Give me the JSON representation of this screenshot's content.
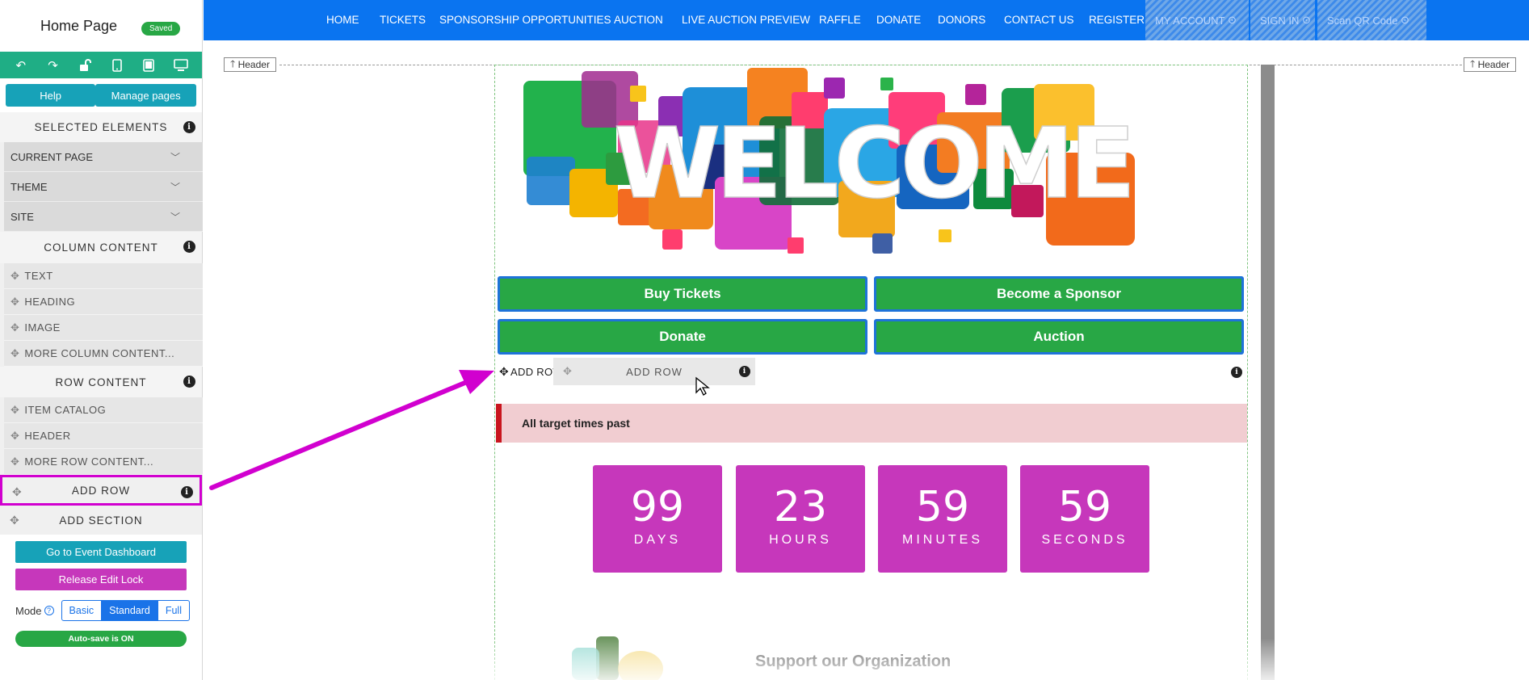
{
  "sidebar": {
    "page_title": "Home Page",
    "saved_badge": "Saved",
    "tools": [
      "undo-icon",
      "redo-icon",
      "lock-open-icon",
      "mobile-icon",
      "tablet-icon",
      "desktop-icon"
    ],
    "help_label": "Help",
    "manage_pages_label": "Manage pages",
    "selected_elements": "SELECTED ELEMENTS",
    "dropdowns": [
      "CURRENT PAGE",
      "THEME",
      "SITE"
    ],
    "column_content": "COLUMN CONTENT",
    "column_items": [
      "TEXT",
      "HEADING",
      "IMAGE",
      "MORE COLUMN CONTENT..."
    ],
    "row_content": "ROW CONTENT",
    "row_items": [
      "ITEM CATALOG",
      "HEADER",
      "MORE ROW CONTENT..."
    ],
    "add_row": "ADD ROW",
    "add_section": "ADD SECTION",
    "event_dashboard": "Go to Event Dashboard",
    "release_lock": "Release Edit Lock",
    "mode_label": "Mode",
    "modes": [
      "Basic",
      "Standard",
      "Full"
    ],
    "active_mode": "Standard",
    "autosave": "Auto-save is ON"
  },
  "nav": {
    "items": [
      "HOME",
      "TICKETS",
      "SPONSORSHIP OPPORTUNITIES",
      "AUCTION",
      "LIVE AUCTION PREVIEW",
      "RAFFLE",
      "DONATE",
      "DONORS",
      "CONTACT US",
      "REGISTER"
    ],
    "hatched": [
      "MY ACCOUNT",
      "SIGN IN",
      "Scan QR Code"
    ]
  },
  "canvas": {
    "header_tag": "Header",
    "welcome_text": "WELCOME",
    "buttons": [
      "Buy Tickets",
      "Become a Sponsor",
      "Donate",
      "Auction"
    ],
    "add_row_inline": "ADD ROW",
    "add_row_ghost": "ADD ROW",
    "alert_text": "All target times past",
    "countdown": [
      {
        "value": "99",
        "unit": "DAYS"
      },
      {
        "value": "23",
        "unit": "HOURS"
      },
      {
        "value": "59",
        "unit": "MINUTES"
      },
      {
        "value": "59",
        "unit": "SECONDS"
      }
    ],
    "support_heading": "Support our Organization"
  },
  "colors": {
    "nav_bg": "#0a74f0",
    "toolbar_bg": "#1fae85",
    "highlight": "#d100cf",
    "cta_green": "#28a745",
    "countdown_bg": "#c637bb",
    "alert_bg": "#f1cdd1"
  }
}
